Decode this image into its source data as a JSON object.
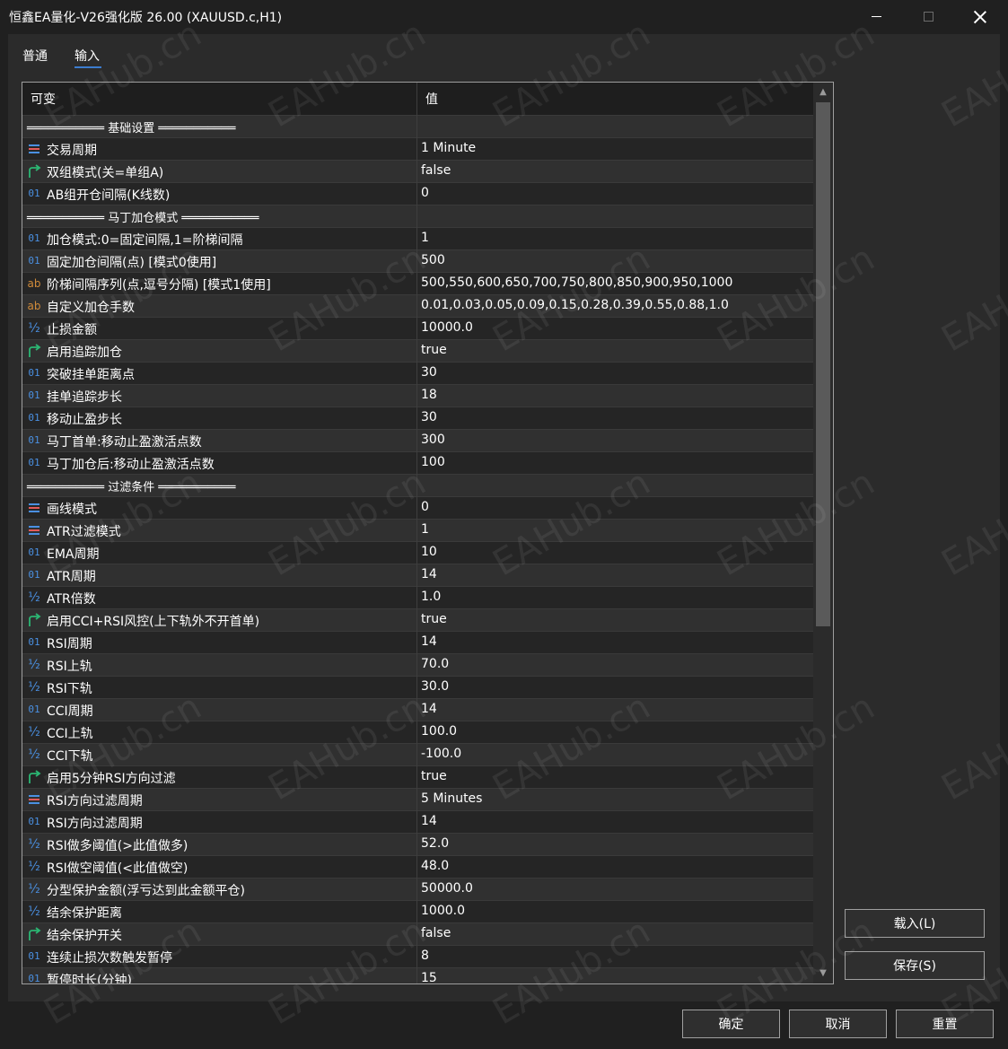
{
  "window": {
    "title": "恒鑫EA量化-V26强化版 26.00 (XAUUSD.c,H1)"
  },
  "tabs": [
    {
      "label": "普通"
    },
    {
      "label": "输入"
    }
  ],
  "grid": {
    "headers": {
      "variable": "可变",
      "value": "值"
    },
    "rows": [
      {
        "type": "sep",
        "name": "═══════════ 基础设置 ═══════════",
        "value": ""
      },
      {
        "type": "enum",
        "name": "交易周期",
        "value": "1 Minute"
      },
      {
        "type": "bool",
        "name": "双组模式(关=单组A)",
        "value": "false"
      },
      {
        "type": "int",
        "name": "AB组开仓间隔(K线数)",
        "value": "0"
      },
      {
        "type": "sep",
        "name": "═══════════ 马丁加仓模式 ═══════════",
        "value": ""
      },
      {
        "type": "int",
        "name": "加仓模式:0=固定间隔,1=阶梯间隔",
        "value": "1"
      },
      {
        "type": "int",
        "name": "固定加仓间隔(点) [模式0使用]",
        "value": "500"
      },
      {
        "type": "str",
        "name": "阶梯间隔序列(点,逗号分隔) [模式1使用]",
        "value": "500,550,600,650,700,750,800,850,900,950,1000"
      },
      {
        "type": "str",
        "name": "自定义加仓手数",
        "value": "0.01,0.03,0.05,0.09,0.15,0.28,0.39,0.55,0.88,1.0"
      },
      {
        "type": "dbl",
        "name": "止损金额",
        "value": "10000.0"
      },
      {
        "type": "bool",
        "name": "启用追踪加仓",
        "value": "true"
      },
      {
        "type": "int",
        "name": "突破挂单距离点",
        "value": "30"
      },
      {
        "type": "int",
        "name": "挂单追踪步长",
        "value": "18"
      },
      {
        "type": "int",
        "name": "移动止盈步长",
        "value": "30"
      },
      {
        "type": "int",
        "name": "马丁首单:移动止盈激活点数",
        "value": "300"
      },
      {
        "type": "int",
        "name": "马丁加仓后:移动止盈激活点数",
        "value": "100"
      },
      {
        "type": "sep",
        "name": "═══════════ 过滤条件 ═══════════",
        "value": ""
      },
      {
        "type": "enum",
        "name": "画线模式",
        "value": "0"
      },
      {
        "type": "enum",
        "name": "ATR过滤模式",
        "value": "1"
      },
      {
        "type": "int",
        "name": "EMA周期",
        "value": "10"
      },
      {
        "type": "int",
        "name": "ATR周期",
        "value": "14"
      },
      {
        "type": "dbl",
        "name": "ATR倍数",
        "value": "1.0"
      },
      {
        "type": "bool",
        "name": "启用CCI+RSI风控(上下轨外不开首单)",
        "value": "true"
      },
      {
        "type": "int",
        "name": "RSI周期",
        "value": "14"
      },
      {
        "type": "dbl",
        "name": "RSI上轨",
        "value": "70.0"
      },
      {
        "type": "dbl",
        "name": "RSI下轨",
        "value": "30.0"
      },
      {
        "type": "int",
        "name": "CCI周期",
        "value": "14"
      },
      {
        "type": "dbl",
        "name": "CCI上轨",
        "value": "100.0"
      },
      {
        "type": "dbl",
        "name": "CCI下轨",
        "value": "-100.0"
      },
      {
        "type": "bool",
        "name": "启用5分钟RSI方向过滤",
        "value": "true"
      },
      {
        "type": "enum",
        "name": "RSI方向过滤周期",
        "value": "5 Minutes"
      },
      {
        "type": "int",
        "name": "RSI方向过滤周期",
        "value": "14"
      },
      {
        "type": "dbl",
        "name": "RSI做多阈值(>此值做多)",
        "value": "52.0"
      },
      {
        "type": "dbl",
        "name": "RSI做空阈值(<此值做空)",
        "value": "48.0"
      },
      {
        "type": "dbl",
        "name": "分型保护金额(浮亏达到此金额平仓)",
        "value": "50000.0"
      },
      {
        "type": "dbl",
        "name": "结余保护距离",
        "value": "1000.0"
      },
      {
        "type": "bool",
        "name": "结余保护开关",
        "value": "false"
      },
      {
        "type": "int",
        "name": "连续止损次数触发暂停",
        "value": "8"
      },
      {
        "type": "int",
        "name": "暂停时长(分钟)",
        "value": "15"
      }
    ]
  },
  "icons": {
    "int": "01",
    "dbl": "½",
    "str": "ab"
  },
  "buttons": {
    "load": "载入(L)",
    "save": "保存(S)",
    "ok": "确定",
    "cancel": "取消",
    "reset": "重置"
  },
  "watermark": "EAHub.cn",
  "colors": {
    "background": "#202020",
    "panel": "#2b2b2b",
    "accent": "#3c7ccf",
    "int_icon": "#4a90e2",
    "str_icon": "#d08b3a",
    "bool_icon": "#2bb673"
  }
}
